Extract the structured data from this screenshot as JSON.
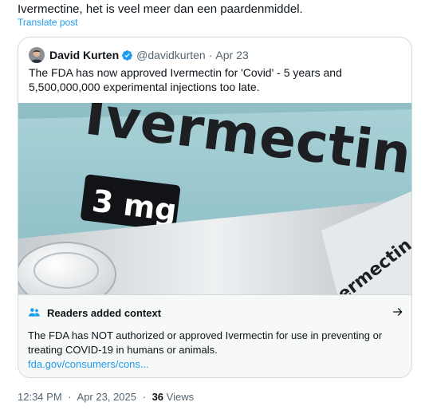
{
  "post": {
    "text": "Ivermectine, het is veel meer dan een paardenmiddel.",
    "translate_label": "Translate post"
  },
  "quote": {
    "author_name": "David Kurten",
    "handle": "@davidkurten",
    "dot": "·",
    "date": "Apr 23",
    "text": "The FDA has now approved Ivermectin for 'Covid' - 5 years and 5,500,000,000 experimental injections too late.",
    "media": {
      "box_brand": "Ivermectin",
      "dose": "3 mg",
      "blister_text": "Ivermectin",
      "colors": {
        "box": "#9fcbd1",
        "band": "#111316",
        "blister": "#d9dde0"
      }
    }
  },
  "context": {
    "title": "Readers added context",
    "icon": "people-icon",
    "arrow_icon": "arrow-right-icon",
    "body": "The FDA has NOT authorized or approved Ivermectin for use in preventing or treating COVID-19 in humans or animals.",
    "link": "fda.gov/consumers/cons..."
  },
  "meta": {
    "time": "12:34 PM",
    "dot": "·",
    "date": "Apr 23, 2025",
    "dot2": "·",
    "views_count": "36",
    "views_label": "Views"
  },
  "colors": {
    "accent": "#1d9bf0",
    "text": "#0f1419",
    "muted": "#536471",
    "border": "#cfd9de",
    "verified": "#1d9bf0"
  }
}
